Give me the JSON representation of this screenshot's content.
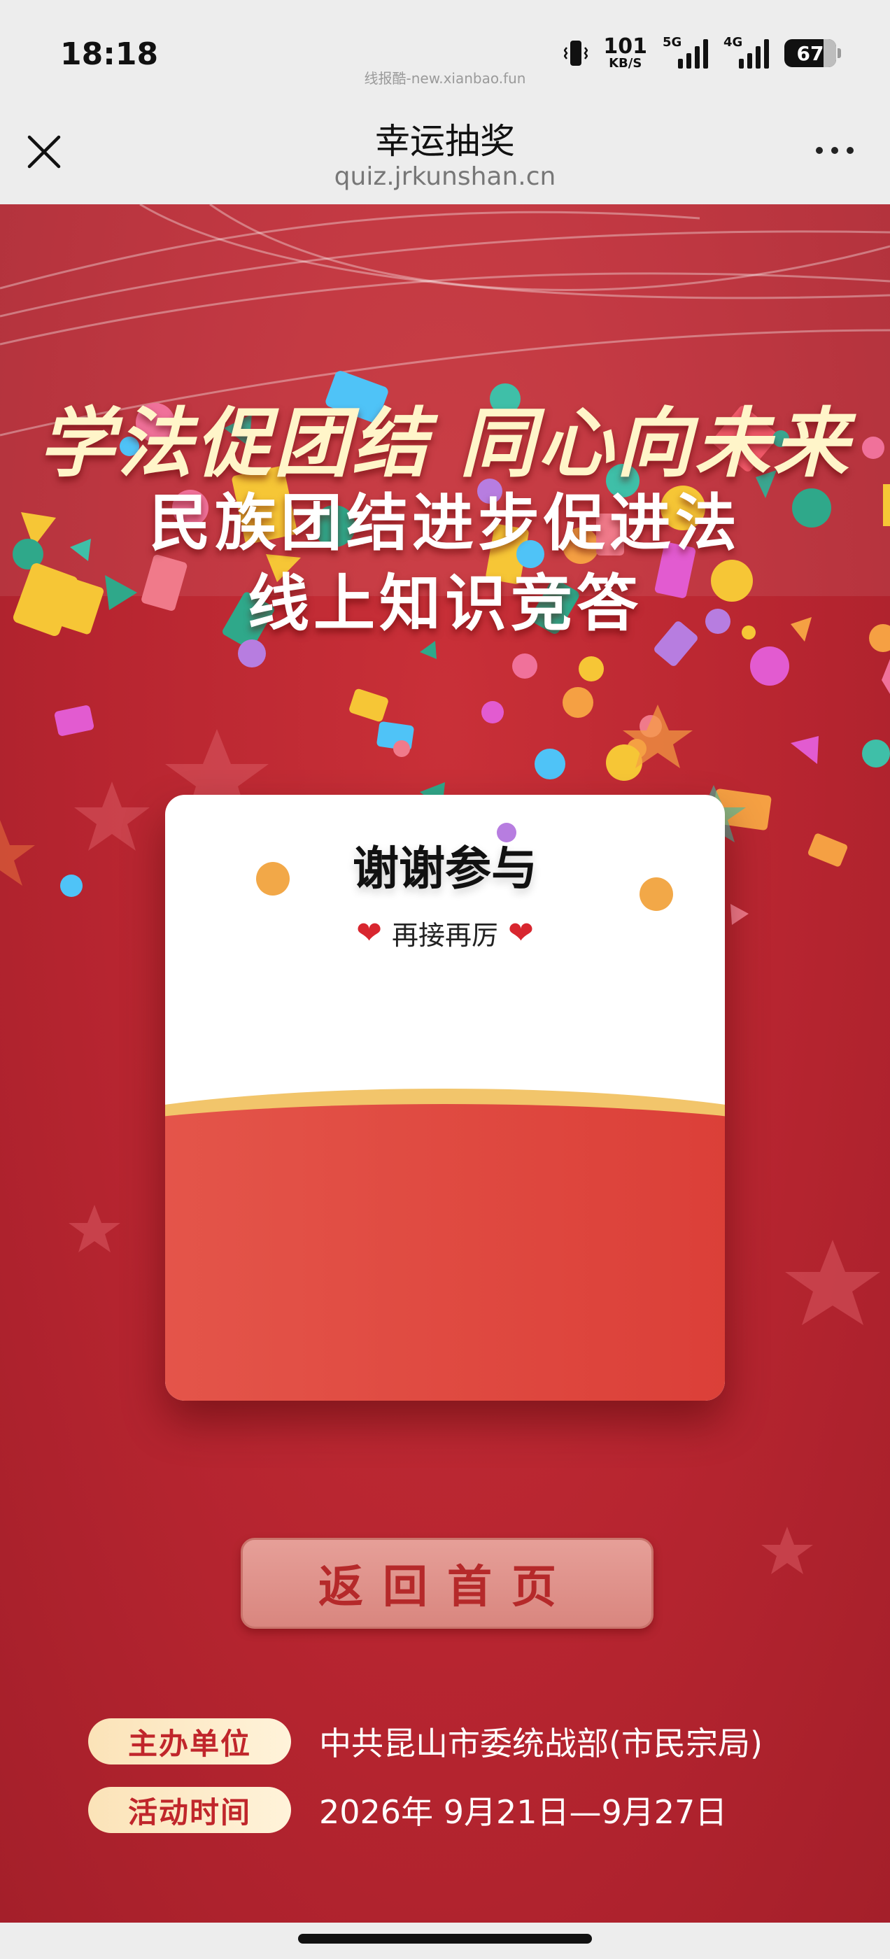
{
  "status_bar": {
    "time": "18:18",
    "watermark": "线报酷-new.xianbao.fun",
    "net_speed_value": "101",
    "net_speed_unit": "KB/S",
    "signal1_tag": "5G",
    "signal2_tag": "4G",
    "battery": "67"
  },
  "nav": {
    "title": "幸运抽奖",
    "url": "quiz.jrkunshan.cn",
    "close_icon": "close-icon",
    "more_icon": "more-icon"
  },
  "banner": {
    "line1": "学法促团结 同心向未来",
    "line2": "民族团结进步促进法",
    "line3": "线上知识竞答"
  },
  "result_card": {
    "title": "谢谢参与",
    "subtitle": "再接再厉",
    "heart": "❤"
  },
  "return_button": {
    "label": "返回首页"
  },
  "info": {
    "organizer_label": "主办单位",
    "organizer_value": "中共昆山市委统战部(市民宗局)",
    "time_label": "活动时间",
    "time_value": "2026年 9月21日—9月27日"
  },
  "colors": {
    "background_red": "#b9262f",
    "card_gold": "#f2c56b",
    "label_text": "#c0262b"
  }
}
